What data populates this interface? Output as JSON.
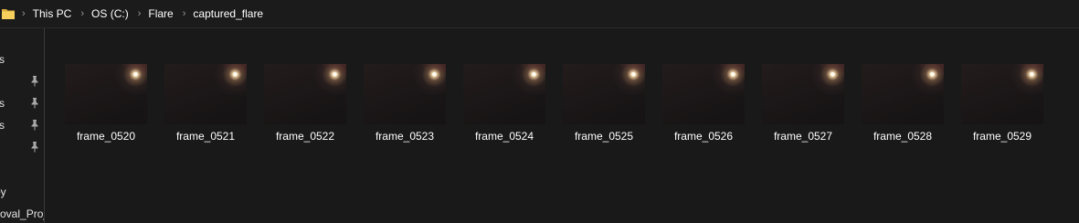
{
  "address_bar": {
    "folder_icon": "folder-icon",
    "separator_icon": "chevron-right-icon",
    "breadcrumbs": [
      {
        "label": "This PC"
      },
      {
        "label": "OS (C:)"
      },
      {
        "label": "Flare"
      },
      {
        "label": "captured_flare"
      }
    ]
  },
  "nav_pane": {
    "items": [
      {
        "label": "s",
        "pinned": false
      },
      {
        "label": "",
        "pinned": true
      },
      {
        "label": "s",
        "pinned": true
      },
      {
        "label": "s",
        "pinned": true
      },
      {
        "label": "",
        "pinned": true
      },
      {
        "label": "py",
        "pinned": false
      },
      {
        "label": "oval_Proj",
        "pinned": false
      }
    ]
  },
  "files": [
    {
      "name": "frame_0520"
    },
    {
      "name": "frame_0521"
    },
    {
      "name": "frame_0522"
    },
    {
      "name": "frame_0523"
    },
    {
      "name": "frame_0524"
    },
    {
      "name": "frame_0525"
    },
    {
      "name": "frame_0526"
    },
    {
      "name": "frame_0527"
    },
    {
      "name": "frame_0528"
    },
    {
      "name": "frame_0529"
    }
  ],
  "colors": {
    "background": "#191919",
    "text": "#ffffff",
    "folder_icon": "#f2c94c",
    "separator": "#9c9c9c"
  }
}
